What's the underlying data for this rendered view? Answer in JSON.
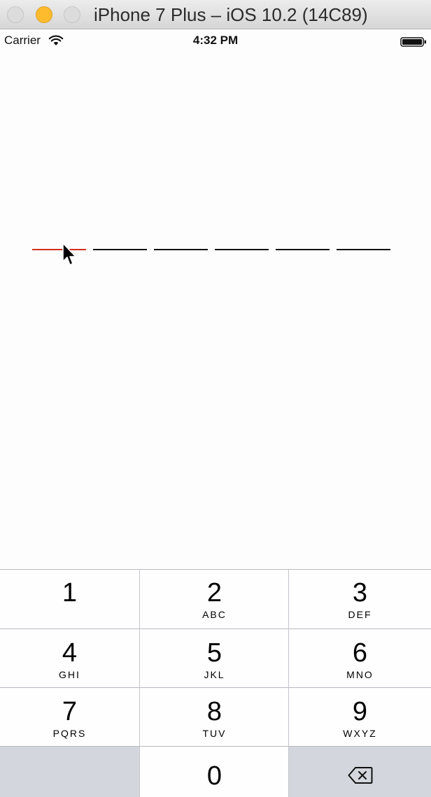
{
  "window": {
    "title": "iPhone 7 Plus – iOS 10.2 (14C89)",
    "traffic_lights": [
      "close-button",
      "minimize-button",
      "zoom-button"
    ]
  },
  "status_bar": {
    "carrier": "Carrier",
    "time": "4:32 PM",
    "icons": [
      "wifi-icon",
      "battery-icon"
    ]
  },
  "code_entry": {
    "field_count": 6,
    "active_index": 0,
    "colors": {
      "active": "#d0301c",
      "inactive": "#111111"
    }
  },
  "keypad": {
    "keys": [
      {
        "digit": "1",
        "letters": ""
      },
      {
        "digit": "2",
        "letters": "ABC"
      },
      {
        "digit": "3",
        "letters": "DEF"
      },
      {
        "digit": "4",
        "letters": "GHI"
      },
      {
        "digit": "5",
        "letters": "JKL"
      },
      {
        "digit": "6",
        "letters": "MNO"
      },
      {
        "digit": "7",
        "letters": "PQRS"
      },
      {
        "digit": "8",
        "letters": "TUV"
      },
      {
        "digit": "9",
        "letters": "WXYZ"
      }
    ],
    "zero": {
      "digit": "0"
    },
    "delete_icon": "backspace-icon"
  }
}
